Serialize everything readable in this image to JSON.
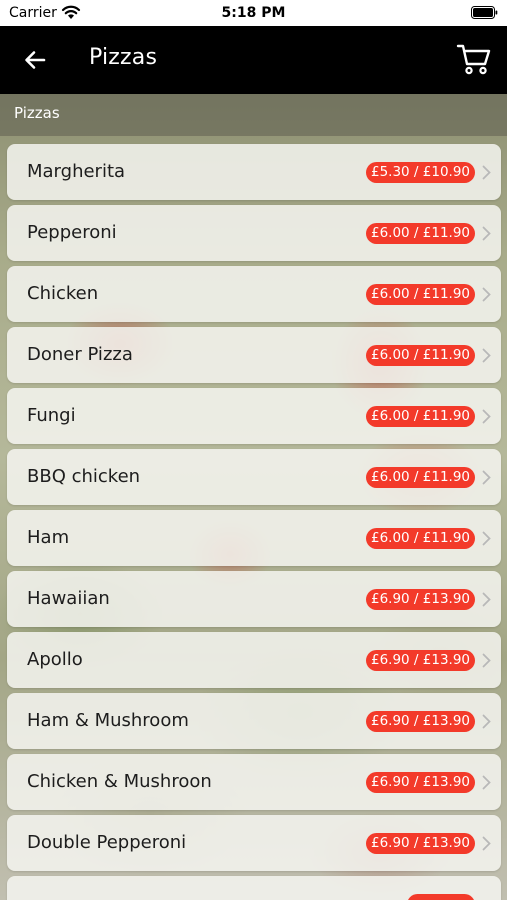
{
  "status_bar": {
    "carrier": "Carrier",
    "time": "5:18 PM"
  },
  "nav": {
    "title": "Pizzas",
    "back_icon": "arrow-left-icon",
    "cart_icon": "cart-icon"
  },
  "section": {
    "title": "Pizzas"
  },
  "colors": {
    "price_badge": "#f33a2a",
    "nav_background": "#000000"
  },
  "menu_items": [
    {
      "name": "Margherita",
      "price": "£5.30 / £10.90"
    },
    {
      "name": "Pepperoni",
      "price": "£6.00 / £11.90"
    },
    {
      "name": "Chicken",
      "price": "£6.00 / £11.90"
    },
    {
      "name": "Doner Pizza",
      "price": "£6.00 / £11.90"
    },
    {
      "name": "Fungi",
      "price": "£6.00 / £11.90"
    },
    {
      "name": "BBQ chicken",
      "price": "£6.00 / £11.90"
    },
    {
      "name": "Ham",
      "price": "£6.00 / £11.90"
    },
    {
      "name": "Hawaiian",
      "price": "£6.90 / £13.90"
    },
    {
      "name": "Apollo",
      "price": "£6.90 / £13.90"
    },
    {
      "name": "Ham & Mushroom",
      "price": "£6.90 / £13.90"
    },
    {
      "name": "Chicken & Mushroon",
      "price": "£6.90 / £13.90"
    },
    {
      "name": "Double Pepperoni",
      "price": "£6.90 / £13.90"
    },
    {
      "name": "",
      "price": ""
    }
  ]
}
